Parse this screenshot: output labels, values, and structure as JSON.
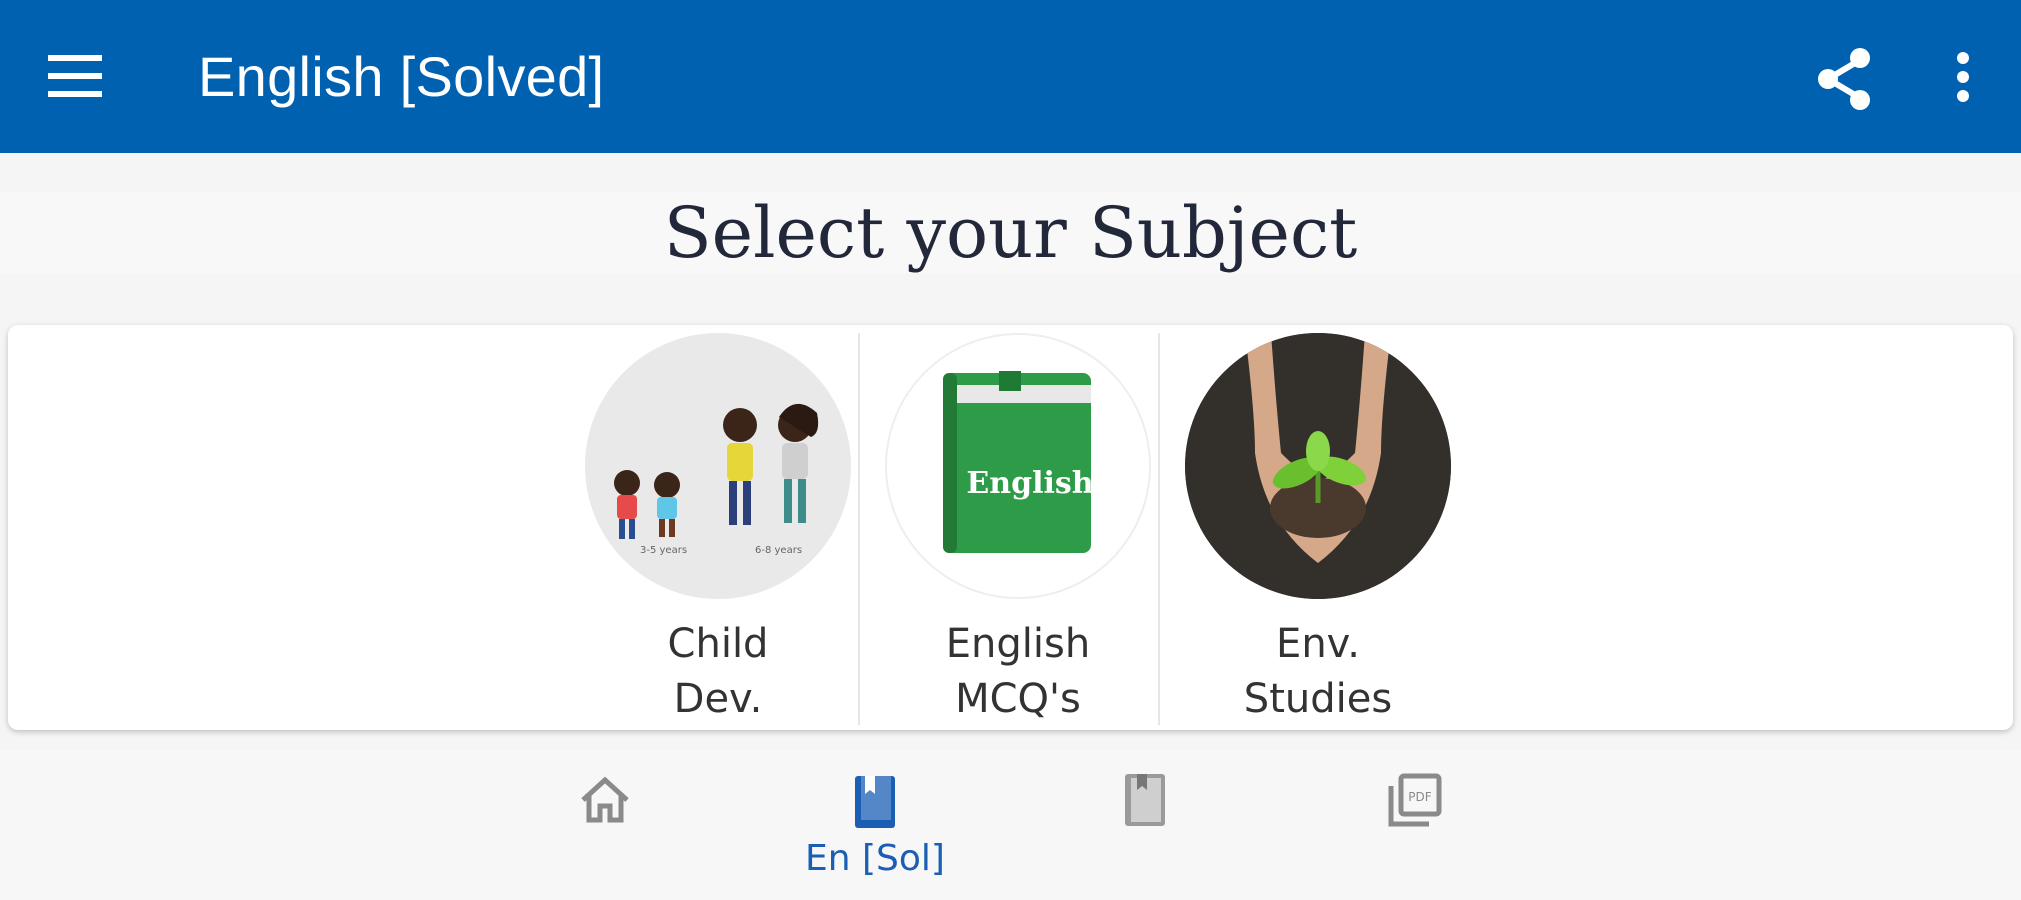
{
  "app_bar": {
    "title": "English [Solved]",
    "menu_icon": "hamburger-menu-icon",
    "share_icon": "share-icon",
    "more_icon": "more-vert-icon",
    "background_color": "#0061b0"
  },
  "heading": "Select your Subject",
  "subjects": [
    {
      "label_line1": "Child",
      "label_line2": "Dev.",
      "image": "children-illustration",
      "caption_left": "3-5 years",
      "caption_right": "6-8 years"
    },
    {
      "label_line1": "English",
      "label_line2": "MCQ's",
      "image": "green-book",
      "book_text": "English"
    },
    {
      "label_line1": "Env.",
      "label_line2": "Studies",
      "image": "hands-holding-plant"
    }
  ],
  "bottom_nav": {
    "items": [
      {
        "icon": "home-icon",
        "label": "",
        "selected": false
      },
      {
        "icon": "bookmark-book-icon",
        "label": "En [Sol]",
        "selected": true
      },
      {
        "icon": "book-icon",
        "label": "",
        "selected": false
      },
      {
        "icon": "pdf-icon",
        "label": "",
        "selected": false,
        "pdf_text": "PDF"
      }
    ],
    "selected_color": "#1a5fb4",
    "icon_color": "#8a8a8a"
  }
}
